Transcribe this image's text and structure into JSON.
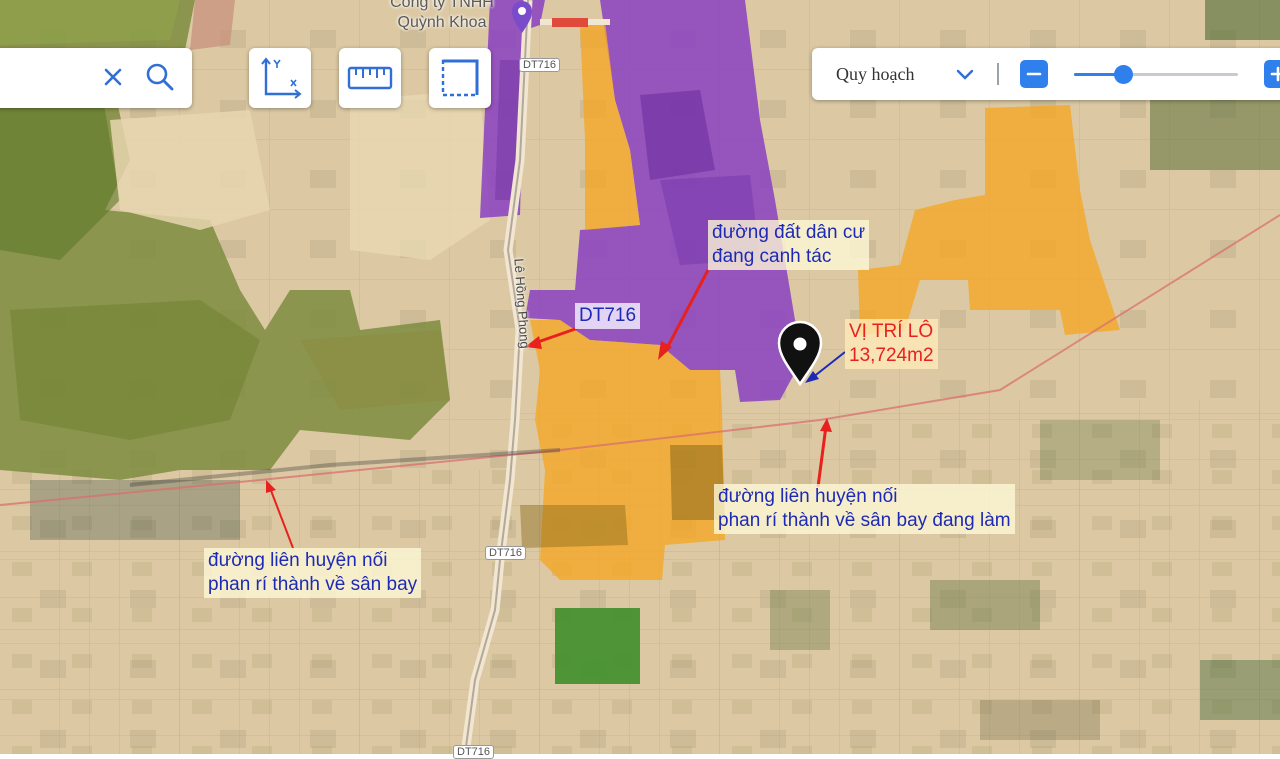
{
  "map": {
    "company_label_line1": "Công ty TNHH",
    "company_label_line2": "Quỳnh Khoa",
    "road_shields": [
      "DT716",
      "DT716",
      "DT716"
    ],
    "street_label": "Lê Hồng Phong"
  },
  "search": {
    "clear_icon": "close-icon",
    "search_icon": "search-icon"
  },
  "toolbar": {
    "coordinate_icon": "xy-axis-icon",
    "measure_icon": "ruler-icon",
    "area_icon": "dashed-square-icon"
  },
  "layer_panel": {
    "selected_layer": "Quy hoạch",
    "zoom_level": 0.3
  },
  "annotations": {
    "residential_road_line1": "đường đất dân cư",
    "residential_road_line2": "đang canh tác",
    "dt716": "DT716",
    "lot_line1": "VỊ TRÍ LÔ",
    "lot_line2": "13,724m2",
    "road_building_line1": "đường liên huyện nối",
    "road_building_line2": "phan rí thành về sân bay đang làm",
    "road_line1": "đường liên huyện nối",
    "road_line2": "phan rí thành về sân bay"
  },
  "colors": {
    "accent": "#2f80ed",
    "annotation_blue": "#1d2ab5",
    "annotation_red": "#e8211f",
    "planning_purple": "#8a3fc2",
    "planning_orange": "#f5a623"
  }
}
